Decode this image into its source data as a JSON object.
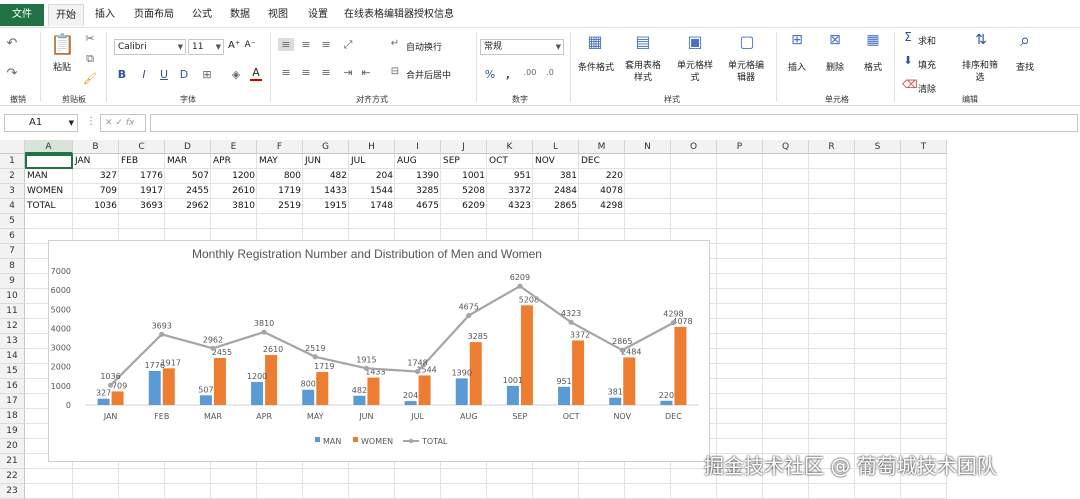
{
  "menu": {
    "file": "文件",
    "tabs": [
      "开始",
      "插入",
      "页面布局",
      "公式",
      "数据",
      "视图",
      "设置",
      "在线表格编辑器授权信息"
    ]
  },
  "ribbon": {
    "undo_group": "撤销",
    "clipboard": {
      "label": "剪贴板",
      "paste": "粘贴"
    },
    "font": {
      "label": "字体",
      "name": "Calibri",
      "size": "11"
    },
    "alignment": {
      "label": "对齐方式",
      "wrap": "自动换行",
      "merge": "合并后居中"
    },
    "number": {
      "label": "数字",
      "format": "常规"
    },
    "styles": {
      "label": "样式",
      "conditional": "条件格式",
      "table_format": "套用表格样式",
      "cell_style": "单元格样式",
      "cell_editor": "单元格编辑器"
    },
    "cells": {
      "label": "单元格",
      "insert": "插入",
      "delete": "删除",
      "format": "格式"
    },
    "editing": {
      "label": "编辑",
      "sum": "求和",
      "fill": "填充",
      "clear": "清除",
      "sort": "排序和筛选",
      "find": "查找"
    }
  },
  "formula_bar": {
    "cell_ref": "A1",
    "fx": "fx",
    "value": ""
  },
  "sheet": {
    "columns": [
      "A",
      "B",
      "C",
      "D",
      "E",
      "F",
      "G",
      "H",
      "I",
      "J",
      "K",
      "L",
      "M",
      "N",
      "O",
      "P",
      "Q",
      "R",
      "S",
      "T"
    ],
    "rows": [
      "1",
      "2",
      "3",
      "4",
      "5",
      "6",
      "7",
      "8",
      "9",
      "10",
      "11",
      "12",
      "13",
      "14",
      "15",
      "16",
      "17",
      "18",
      "19",
      "20",
      "21",
      "22",
      "23"
    ],
    "header_row": [
      "",
      "JAN",
      "FEB",
      "MAR",
      "APR",
      "MAY",
      "JUN",
      "JUL",
      "AUG",
      "SEP",
      "OCT",
      "NOV",
      "DEC"
    ],
    "data": [
      {
        "label": "MAN",
        "values": [
          "327",
          "1776",
          "507",
          "1200",
          "800",
          "482",
          "204",
          "1390",
          "1001",
          "951",
          "381",
          "220"
        ]
      },
      {
        "label": "WOMEN",
        "values": [
          "709",
          "1917",
          "2455",
          "2610",
          "1719",
          "1433",
          "1544",
          "3285",
          "5208",
          "3372",
          "2484",
          "4078"
        ]
      },
      {
        "label": "TOTAL",
        "values": [
          "1036",
          "3693",
          "2962",
          "3810",
          "2519",
          "1915",
          "1748",
          "4675",
          "6209",
          "4323",
          "2865",
          "4298"
        ]
      }
    ]
  },
  "chart_data": {
    "type": "bar",
    "title": "Monthly Registration Number and Distribution of Men and Women",
    "categories": [
      "JAN",
      "FEB",
      "MAR",
      "APR",
      "MAY",
      "JUN",
      "JUL",
      "AUG",
      "SEP",
      "OCT",
      "NOV",
      "DEC"
    ],
    "ylim": [
      0,
      7000
    ],
    "yticks": [
      "0",
      "1000",
      "2000",
      "3000",
      "4000",
      "5000",
      "6000",
      "7000"
    ],
    "series": [
      {
        "name": "MAN",
        "type": "bar",
        "color": "#5b9bd5",
        "values": [
          327,
          1776,
          507,
          1200,
          800,
          482,
          204,
          1390,
          1001,
          951,
          381,
          220
        ]
      },
      {
        "name": "WOMEN",
        "type": "bar",
        "color": "#ed7d31",
        "values": [
          709,
          1917,
          2455,
          2610,
          1719,
          1433,
          1544,
          3285,
          5208,
          3372,
          2484,
          4078
        ]
      },
      {
        "name": "TOTAL",
        "type": "line",
        "color": "#a5a5a5",
        "values": [
          1036,
          3693,
          2962,
          3810,
          2519,
          1915,
          1748,
          4675,
          6209,
          4323,
          2865,
          4298
        ]
      }
    ],
    "legend_position": "bottom",
    "grid": false
  },
  "watermark": "掘金技术社区 @ 葡萄城技术团队"
}
